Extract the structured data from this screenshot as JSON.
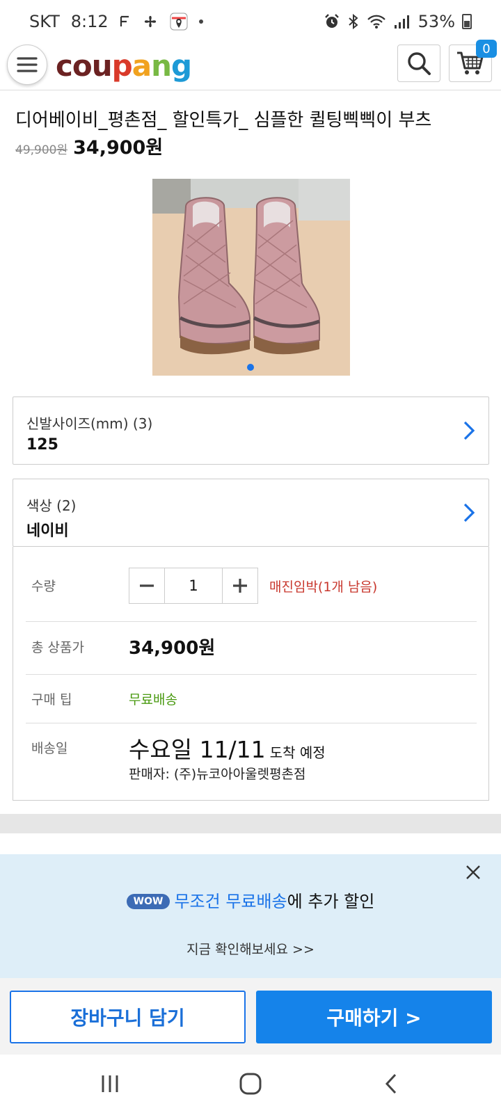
{
  "status_bar": {
    "carrier": "SKT",
    "time": "8:12",
    "battery": "53%"
  },
  "header": {
    "logo": [
      "cou",
      "p",
      "a",
      "n",
      "g"
    ],
    "cart_count": "0"
  },
  "product": {
    "title": "디어베이비_평촌점_ 할인특가_ 심플한 퀼팅삑삑이 부츠",
    "original_price": "49,900원",
    "sale_price": "34,900원"
  },
  "options": [
    {
      "label": "신발사이즈(mm) (3)",
      "value": "125"
    },
    {
      "label": "색상 (2)",
      "value": "네이비"
    }
  ],
  "details": {
    "quantity_label": "수량",
    "quantity_value": "1",
    "stock_notice": "매진임박(1개 남음)",
    "total_label": "총 상품가",
    "total_value": "34,900원",
    "tip_label": "구매 팁",
    "tip_value": "무료배송",
    "delivery_label": "배송일",
    "delivery_date": "수요일 11/11",
    "delivery_suffix": "도착 예정",
    "seller": "판매자: (주)뉴코아아울렛평촌점"
  },
  "promo": {
    "badge": "WOW",
    "highlight": "무조건 무료배송",
    "rest": "에 추가 할인",
    "cta": "지금 확인해보세요 >>"
  },
  "buttons": {
    "add_to_cart": "장바구니 담기",
    "buy": "구매하기 >"
  },
  "colors": {
    "accent": "#1583ea",
    "stock_red": "#c8372d",
    "tip_green": "#4a9a11",
    "promo_bg": "#deeef8"
  }
}
